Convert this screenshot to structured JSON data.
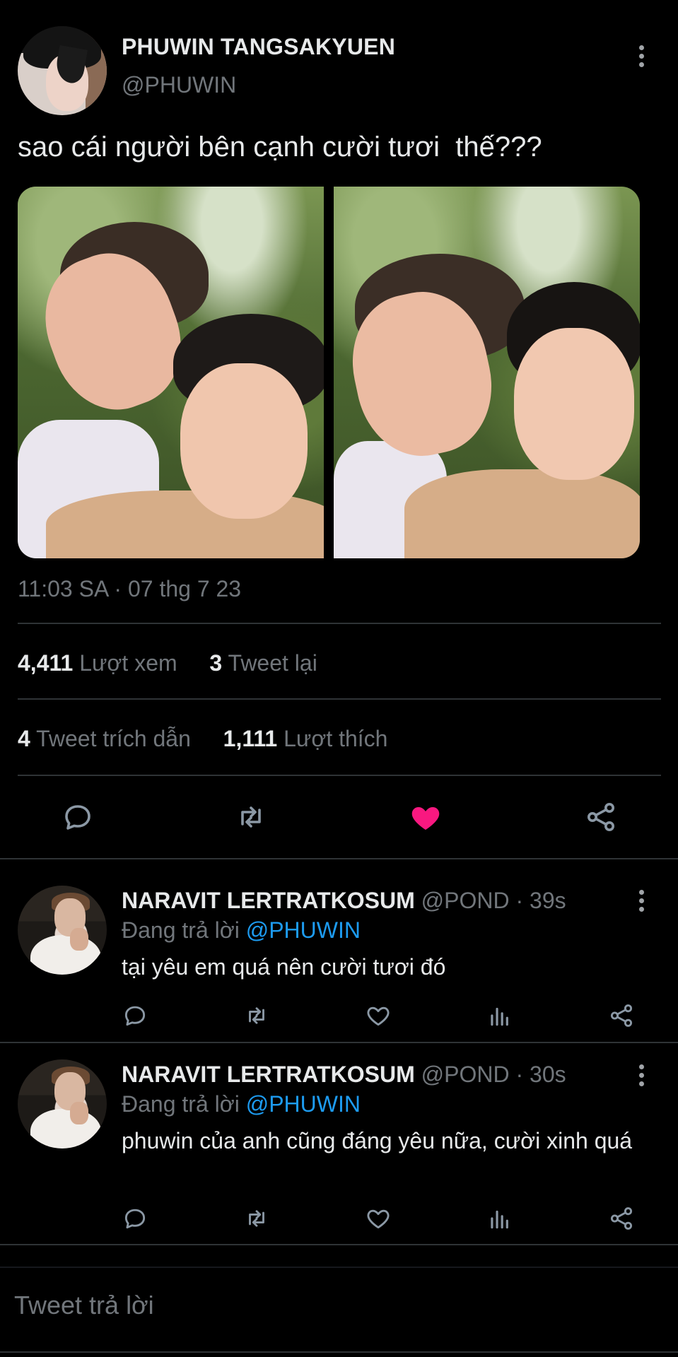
{
  "tweet": {
    "author_name": "PHUWIN TANGSAKYUEN",
    "author_handle": "@PHUWIN",
    "text": "sao cái người bên cạnh cười tươi  thế???",
    "timestamp": "11:03 SA · 07 thg 7 23",
    "stats": {
      "views_count": "4,411",
      "views_label": "Lượt xem",
      "retweets_count": "3",
      "retweets_label": "Tweet lại",
      "quotes_count": "4",
      "quotes_label": "Tweet trích dẫn",
      "likes_count": "1,111",
      "likes_label": "Lượt thích"
    },
    "liked": true,
    "colors": {
      "like": "#f91880",
      "mention": "#1d9bf0",
      "muted": "#71767b"
    }
  },
  "replies": [
    {
      "author_name": "NARAVIT LERTRATKOSUM",
      "author_handle": "@POND",
      "time": "39s",
      "replying_prefix": "Đang trả lời",
      "replying_to": "@PHUWIN",
      "text": "tại yêu em quá nên cười tươi đó"
    },
    {
      "author_name": "NARAVIT LERTRATKOSUM",
      "author_handle": "@POND",
      "time": "30s",
      "replying_prefix": "Đang trả lời",
      "replying_to": "@PHUWIN",
      "text": "phuwin của anh cũng đáng yêu nữa, cười xinh quá"
    }
  ],
  "compose": {
    "placeholder": "Tweet trả lời"
  }
}
